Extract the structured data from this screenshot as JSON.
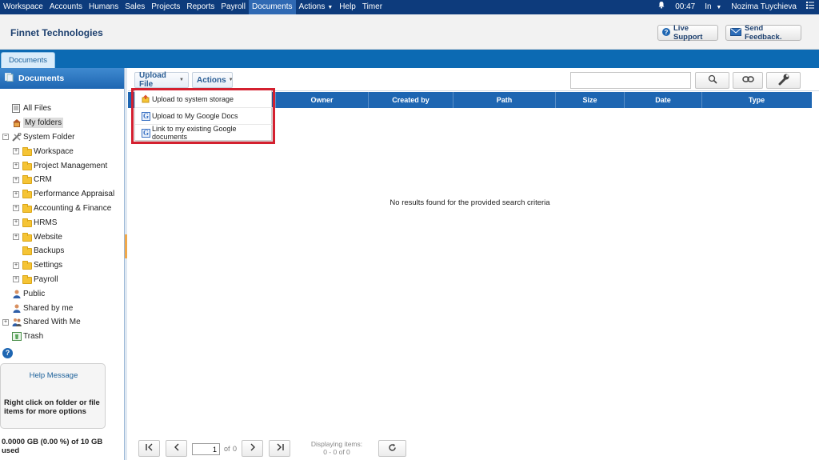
{
  "topnav": {
    "items": [
      "Workspace",
      "Accounts",
      "Humans",
      "Sales",
      "Projects",
      "Reports",
      "Payroll",
      "Documents",
      "Actions",
      "Help",
      "Timer"
    ],
    "active": "Documents",
    "time": "00:47",
    "status": "In",
    "user": "Nozima Tuychieva"
  },
  "header": {
    "company": "Finnet Technologies",
    "live_support": "Live Support",
    "send_feedback": "Send Feedback."
  },
  "tab": {
    "label": "Documents"
  },
  "sidebar": {
    "title": "Documents",
    "items": [
      {
        "label": "All Files"
      },
      {
        "label": "My folders"
      },
      {
        "label": "System Folder"
      },
      {
        "label": "Workspace"
      },
      {
        "label": "Project Management"
      },
      {
        "label": "CRM"
      },
      {
        "label": "Performance Appraisal"
      },
      {
        "label": "Accounting & Finance"
      },
      {
        "label": "HRMS"
      },
      {
        "label": "Website"
      },
      {
        "label": "Backups"
      },
      {
        "label": "Settings"
      },
      {
        "label": "Payroll"
      },
      {
        "label": "Public"
      },
      {
        "label": "Shared by me"
      },
      {
        "label": "Shared With Me"
      },
      {
        "label": "Trash"
      }
    ],
    "help_title": "Help Message",
    "help_text": "Right click on folder or file items for more options",
    "usage": "0.0000 GB (0.00 %) of 10 GB used"
  },
  "toolbar": {
    "upload_label": "Upload File",
    "actions_label": "Actions",
    "search_value": ""
  },
  "upload_menu": {
    "items": [
      "Upload to system storage",
      "Upload to My Google Docs",
      "Link to my existing Google documents"
    ]
  },
  "grid": {
    "columns": [
      "Owner",
      "Created by",
      "Path",
      "Size",
      "Date",
      "Type"
    ],
    "empty_message": "No results found for the provided search criteria"
  },
  "pager": {
    "page": "1",
    "of_label": "of",
    "total_pages": "0",
    "info_label": "Displaying items:",
    "info_range": "0 - 0 of 0"
  },
  "colors": {
    "nav": "#0d3b7c",
    "accent": "#1e66b2",
    "highlight": "#d4202f"
  }
}
